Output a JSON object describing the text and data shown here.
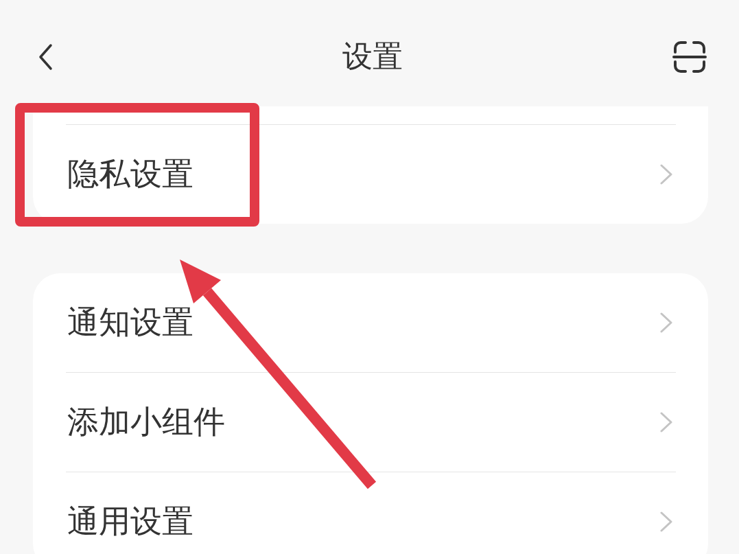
{
  "header": {
    "title": "设置"
  },
  "cards": [
    {
      "clipped_top": true,
      "rows": [
        {
          "label": "隐私设置",
          "highlighted": true,
          "pointed_at": true
        }
      ]
    },
    {
      "clipped_top": false,
      "rows": [
        {
          "label": "通知设置",
          "highlighted": false,
          "pointed_at": false
        },
        {
          "label": "添加小组件",
          "highlighted": false,
          "pointed_at": false
        },
        {
          "label": "通用设置",
          "highlighted": false,
          "pointed_at": false
        }
      ]
    }
  ]
}
